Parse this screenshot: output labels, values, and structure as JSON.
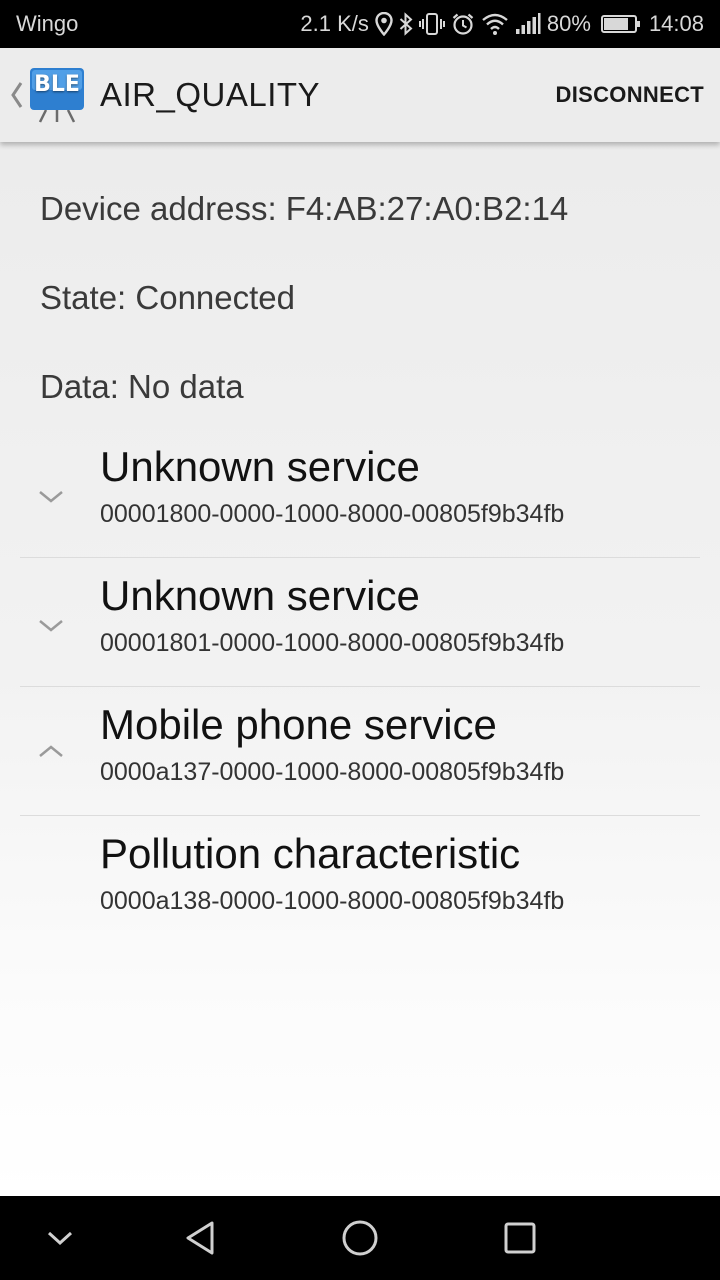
{
  "status_bar": {
    "carrier": "Wingo",
    "speed": "2.1 K/s",
    "battery": "80%",
    "battery_level": 0.8,
    "time": "14:08",
    "icons": [
      "location-icon",
      "bluetooth-icon",
      "vibrate-icon",
      "alarm-icon",
      "wifi-icon",
      "signal-icon",
      "battery-icon"
    ]
  },
  "action_bar": {
    "logo_text": "BLE",
    "title": "AIR_QUALITY",
    "disconnect_label": "DISCONNECT"
  },
  "device": {
    "address": "Device address: F4:AB:27:A0:B2:14",
    "state": "State: Connected",
    "data": "Data: No data"
  },
  "services": [
    {
      "name": "Unknown service",
      "uuid": "00001800-0000-1000-8000-00805f9b34fb",
      "indicator": "chevron-down-icon"
    },
    {
      "name": "Unknown service",
      "uuid": "00001801-0000-1000-8000-00805f9b34fb",
      "indicator": "chevron-down-icon"
    },
    {
      "name": "Mobile phone service",
      "uuid": "0000a137-0000-1000-8000-00805f9b34fb",
      "indicator": "chevron-up-icon"
    }
  ],
  "characteristic": {
    "name": "Pollution characteristic",
    "uuid": "0000a138-0000-1000-8000-00805f9b34fb"
  },
  "nav_bar": {
    "icons": [
      "hide-nav-icon",
      "back-icon",
      "home-icon",
      "recents-icon"
    ]
  },
  "colors": {
    "status_bar_bg": "#000000",
    "action_bar_bg": "#ececec",
    "logo_blue": "#3a8fd8"
  }
}
